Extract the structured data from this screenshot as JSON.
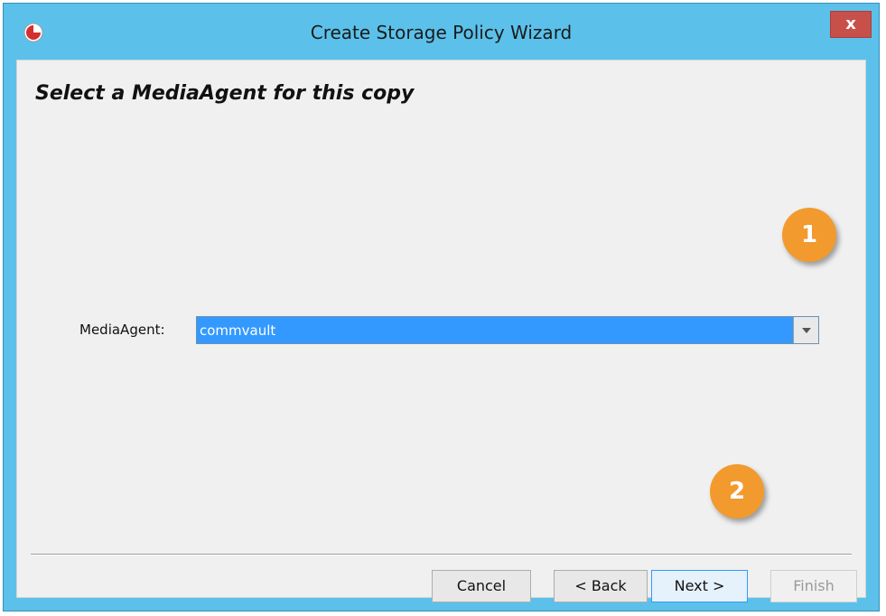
{
  "window": {
    "title": "Create Storage Policy Wizard",
    "close_label": "x",
    "accent": "#5bc1ea"
  },
  "page": {
    "heading": "Select a MediaAgent for this copy"
  },
  "mediaagent": {
    "label": "MediaAgent:",
    "value": "commvault",
    "highlight": "#3399ff"
  },
  "buttons": {
    "cancel": "Cancel",
    "back": "< Back",
    "next": "Next >",
    "finish": "Finish"
  },
  "callouts": {
    "first": "1",
    "second": "2",
    "color": "#f29a2e"
  },
  "icons": {
    "app": "app-logo-icon",
    "dropdown": "chevron-down-icon"
  }
}
